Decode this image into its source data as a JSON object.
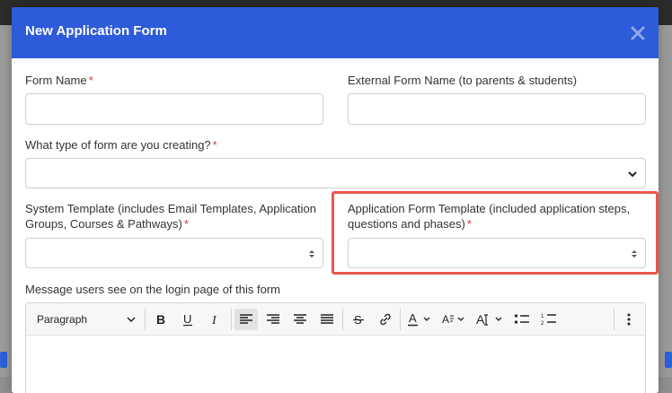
{
  "modal": {
    "title": "New Application Form",
    "close_icon": "close-icon"
  },
  "fields": {
    "form_name": {
      "label": "Form Name",
      "required": "*",
      "value": ""
    },
    "external_form_name": {
      "label": "External Form Name (to parents & students)",
      "value": ""
    },
    "form_type": {
      "label": "What type of form are you creating?",
      "required": "*",
      "value": ""
    },
    "system_template": {
      "label": "System Template (includes Email Templates, Application Groups, Courses & Pathways)",
      "required": "*",
      "value": ""
    },
    "application_form_template": {
      "label": "Application Form Template (included application steps, questions and phases)",
      "required": "*",
      "value": ""
    },
    "login_message": {
      "label": "Message users see on the login page of this form"
    }
  },
  "editor": {
    "paragraph_label": "Paragraph",
    "tools": [
      "bold-icon",
      "underline-icon",
      "italic-icon",
      "align-left-icon",
      "align-right-icon",
      "align-center-icon",
      "align-justify-icon",
      "strikethrough-icon",
      "link-icon",
      "font-color-icon",
      "text-style-icon",
      "font-size-icon",
      "bullet-list-icon",
      "numbered-list-icon",
      "more-vertical-icon"
    ]
  },
  "colors": {
    "header": "#2d5bd9",
    "required": "#d43a3a",
    "highlight": "#e8584c"
  }
}
